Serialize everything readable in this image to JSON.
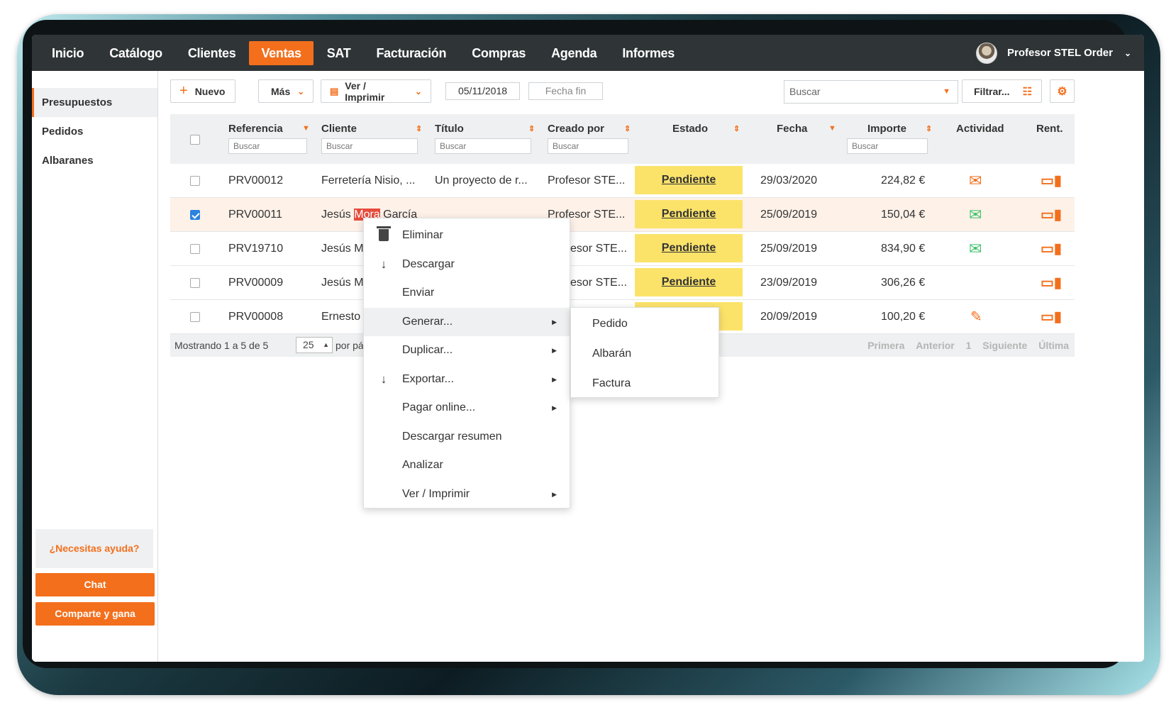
{
  "nav": {
    "items": [
      "Inicio",
      "Catálogo",
      "Clientes",
      "Ventas",
      "SAT",
      "Facturación",
      "Compras",
      "Agenda",
      "Informes"
    ],
    "active": "Ventas",
    "user": "Profesor STEL Order"
  },
  "sidebar": {
    "items": [
      "Presupuestos",
      "Pedidos",
      "Albaranes"
    ],
    "help": "¿Necesitas ayuda?",
    "chat": "Chat",
    "share": "Comparte y gana"
  },
  "toolbar": {
    "new_label": "Nuevo",
    "more_label": "Más",
    "view_print_label": "Ver / Imprimir",
    "date_start": "05/11/2018",
    "date_end_placeholder": "Fecha fin",
    "search_placeholder": "Buscar",
    "filter_label": "Filtrar..."
  },
  "table": {
    "headers": {
      "ref": "Referencia",
      "client": "Cliente",
      "title": "Título",
      "created_by": "Creado por",
      "status": "Estado",
      "date": "Fecha",
      "amount": "Importe",
      "activity": "Actividad",
      "rent": "Rent."
    },
    "filter_placeholder": "Buscar",
    "rows": [
      {
        "ref": "PRV00012",
        "client": "Ferretería Nisio, ...",
        "title": "Un proyecto de r...",
        "created_by": "Profesor STE...",
        "status": "Pendiente",
        "date": "29/03/2020",
        "amount": "224,82 €",
        "activity": "mail-icon",
        "checked": false
      },
      {
        "ref": "PRV00011",
        "client_pre": "Jesús ",
        "client_hl": "Mora",
        "client_post": " García",
        "title": "",
        "created_by": "Profesor STE...",
        "status": "Pendiente",
        "date": "25/09/2019",
        "amount": "150,04 €",
        "activity": "mail-open-icon",
        "checked": true
      },
      {
        "ref": "PRV19710",
        "client": "Jesús M",
        "title": "",
        "created_by": "esor STE...",
        "status": "Pendiente",
        "date": "25/09/2019",
        "amount": "834,90 €",
        "activity": "mail-open-icon",
        "checked": false
      },
      {
        "ref": "PRV00009",
        "client": "Jesús M",
        "title": "",
        "created_by": "esor STE...",
        "status": "Pendiente",
        "date": "23/09/2019",
        "amount": "306,26 €",
        "activity": "",
        "checked": false
      },
      {
        "ref": "PRV00008",
        "client": "Ernesto",
        "title": "",
        "created_by": "",
        "status": "",
        "date": "20/09/2019",
        "amount": "100,20 €",
        "activity": "sign-icon",
        "checked": false
      }
    ],
    "footer": {
      "showing": "Mostrando 1 a 5 de 5",
      "per_page": "25",
      "per_page_label": "por pá",
      "pager": [
        "Primera",
        "Anterior",
        "1",
        "Siguiente",
        "Última"
      ]
    }
  },
  "context_menu": {
    "items": [
      {
        "label": "Eliminar",
        "icon": "trash-icon",
        "submenu": false
      },
      {
        "label": "Descargar",
        "icon": "download-icon",
        "submenu": false
      },
      {
        "label": "Enviar",
        "icon": "",
        "submenu": false
      },
      {
        "label": "Generar...",
        "icon": "",
        "submenu": true
      },
      {
        "label": "Duplicar...",
        "icon": "",
        "submenu": true
      },
      {
        "label": "Exportar...",
        "icon": "download-icon",
        "submenu": true
      },
      {
        "label": "Pagar online...",
        "icon": "",
        "submenu": true
      },
      {
        "label": "Descargar resumen",
        "icon": "",
        "submenu": false
      },
      {
        "label": "Analizar",
        "icon": "",
        "submenu": false
      },
      {
        "label": "Ver / Imprimir",
        "icon": "",
        "submenu": true
      }
    ],
    "hovered": "Generar...",
    "submenu": [
      "Pedido",
      "Albarán",
      "Factura"
    ]
  },
  "colors": {
    "accent": "#f36f1c",
    "nav_bg": "#2f3437",
    "status_pending": "#fbe36a",
    "activity_green": "#3cc36b"
  }
}
